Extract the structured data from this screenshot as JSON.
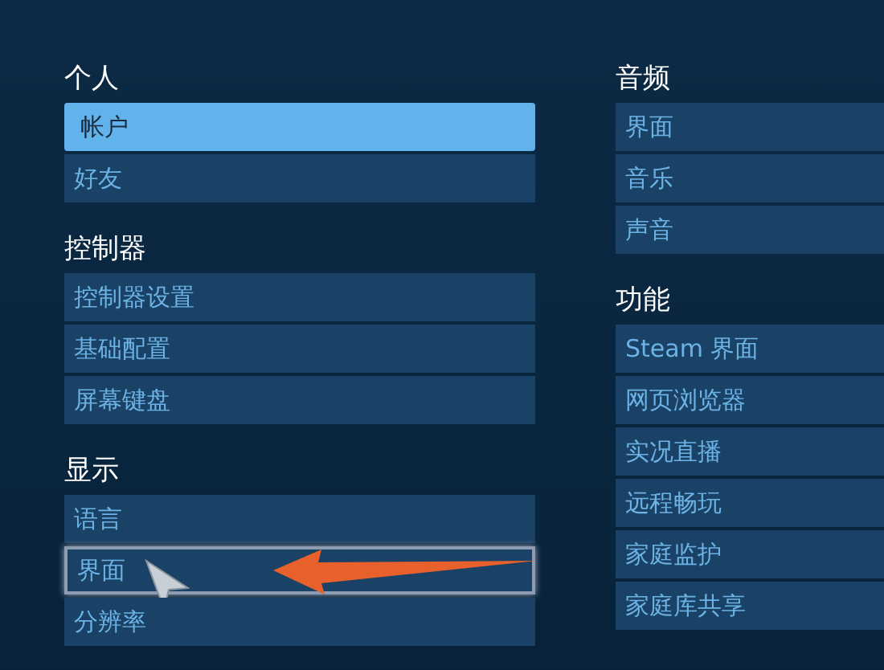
{
  "columns": [
    {
      "sections": [
        {
          "title": "个人",
          "items": [
            {
              "label": "帐户",
              "selected": true,
              "focused": false
            },
            {
              "label": "好友",
              "selected": false,
              "focused": false
            }
          ]
        },
        {
          "title": "控制器",
          "items": [
            {
              "label": "控制器设置",
              "selected": false,
              "focused": false
            },
            {
              "label": "基础配置",
              "selected": false,
              "focused": false
            },
            {
              "label": "屏幕键盘",
              "selected": false,
              "focused": false
            }
          ]
        },
        {
          "title": "显示",
          "items": [
            {
              "label": "语言",
              "selected": false,
              "focused": false
            },
            {
              "label": "界面",
              "selected": false,
              "focused": true
            },
            {
              "label": "分辨率",
              "selected": false,
              "focused": false
            }
          ]
        }
      ]
    },
    {
      "sections": [
        {
          "title": "音频",
          "items": [
            {
              "label": "界面",
              "selected": false,
              "focused": false
            },
            {
              "label": "音乐",
              "selected": false,
              "focused": false
            },
            {
              "label": "声音",
              "selected": false,
              "focused": false
            }
          ]
        },
        {
          "title": "功能",
          "items": [
            {
              "label": "Steam 界面",
              "selected": false,
              "focused": false
            },
            {
              "label": "网页浏览器",
              "selected": false,
              "focused": false
            },
            {
              "label": "实况直播",
              "selected": false,
              "focused": false
            },
            {
              "label": "远程畅玩",
              "selected": false,
              "focused": false
            },
            {
              "label": "家庭监护",
              "selected": false,
              "focused": false
            },
            {
              "label": "家庭库共享",
              "selected": false,
              "focused": false
            }
          ]
        }
      ]
    }
  ]
}
